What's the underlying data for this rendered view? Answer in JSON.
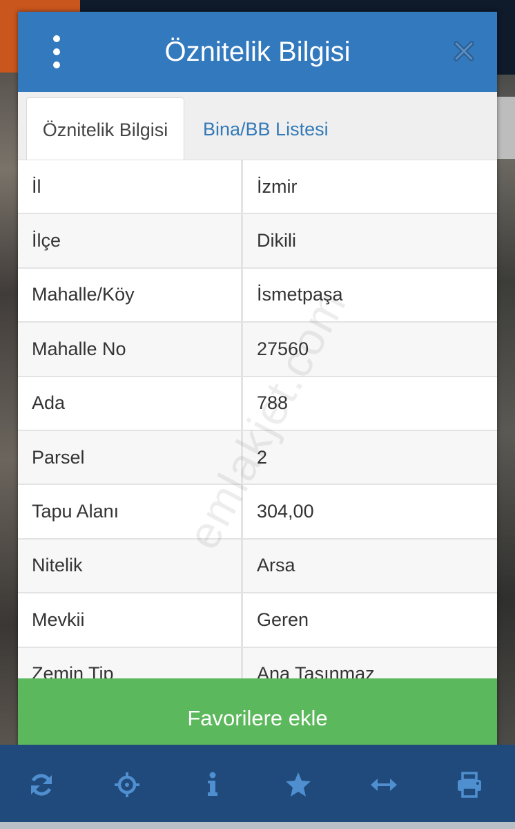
{
  "dialog": {
    "title": "Öznitelik Bilgisi",
    "menu_icon": "more-vertical-icon",
    "close_icon": "close-icon"
  },
  "tabs": [
    {
      "label": "Öznitelik Bilgisi",
      "active": true
    },
    {
      "label": "Bina/BB Listesi",
      "active": false
    }
  ],
  "attributes": [
    {
      "label": "İl",
      "value": "İzmir"
    },
    {
      "label": "İlçe",
      "value": "Dikili"
    },
    {
      "label": "Mahalle/Köy",
      "value": "İsmetpaşa"
    },
    {
      "label": "Mahalle No",
      "value": "27560"
    },
    {
      "label": "Ada",
      "value": "788"
    },
    {
      "label": "Parsel",
      "value": "2"
    },
    {
      "label": "Tapu Alanı",
      "value": "304,00"
    },
    {
      "label": "Nitelik",
      "value": "Arsa"
    },
    {
      "label": "Mevkii",
      "value": "Geren"
    },
    {
      "label": "Zemin Tip",
      "value": "Ana Taşınmaz"
    }
  ],
  "watermark": "emlakjet.com",
  "favorite_button": "Favorilere ekle",
  "toolbar": {
    "icons": [
      "refresh-icon",
      "locate-crosshair-icon",
      "info-icon",
      "star-icon",
      "horizontal-arrows-icon",
      "print-icon"
    ]
  },
  "colors": {
    "header": "#3379be",
    "tab_link": "#337ab7",
    "favorite": "#5cb85c",
    "toolbar": "#1f4a7b",
    "toolbar_icons": "#4f8fd0"
  }
}
